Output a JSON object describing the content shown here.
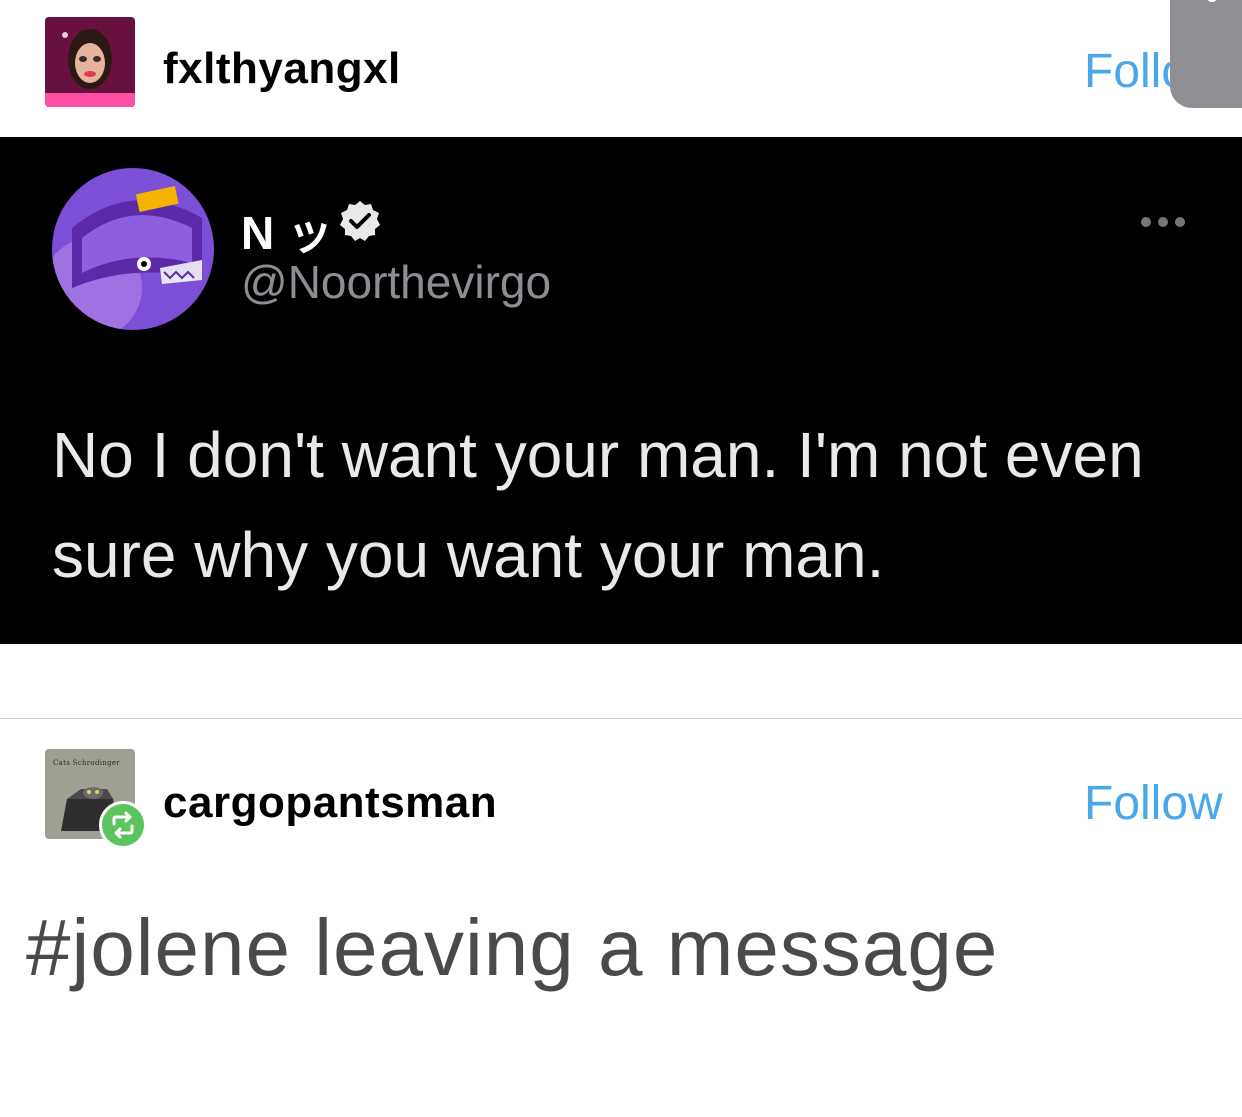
{
  "posts": [
    {
      "username": "fxlthyangxl",
      "follow_label": "Follo",
      "avatar_icon": "profile-avatar",
      "tweet": {
        "display_name": "N ッ",
        "handle": "@Noorthevirgo",
        "verified_icon": "verified-badge-icon",
        "more_icon": "more-options-icon",
        "text": "No I don't want your man. I'm not even sure why you want your man."
      }
    },
    {
      "username": "cargopantsman",
      "follow_label": "Follow",
      "avatar_icon": "profile-avatar",
      "avatar_caption": "Cats Schrodinger",
      "reblog_icon": "reblog-icon",
      "tags": "#jolene leaving a message"
    }
  ],
  "colors": {
    "follow": "#4aa8e8",
    "tweet_bg": "#000000",
    "tweet_text": "#e7e9ea",
    "handle": "#8b8f94",
    "reblog": "#5bc45f",
    "tag_text": "#4a4a4a"
  }
}
